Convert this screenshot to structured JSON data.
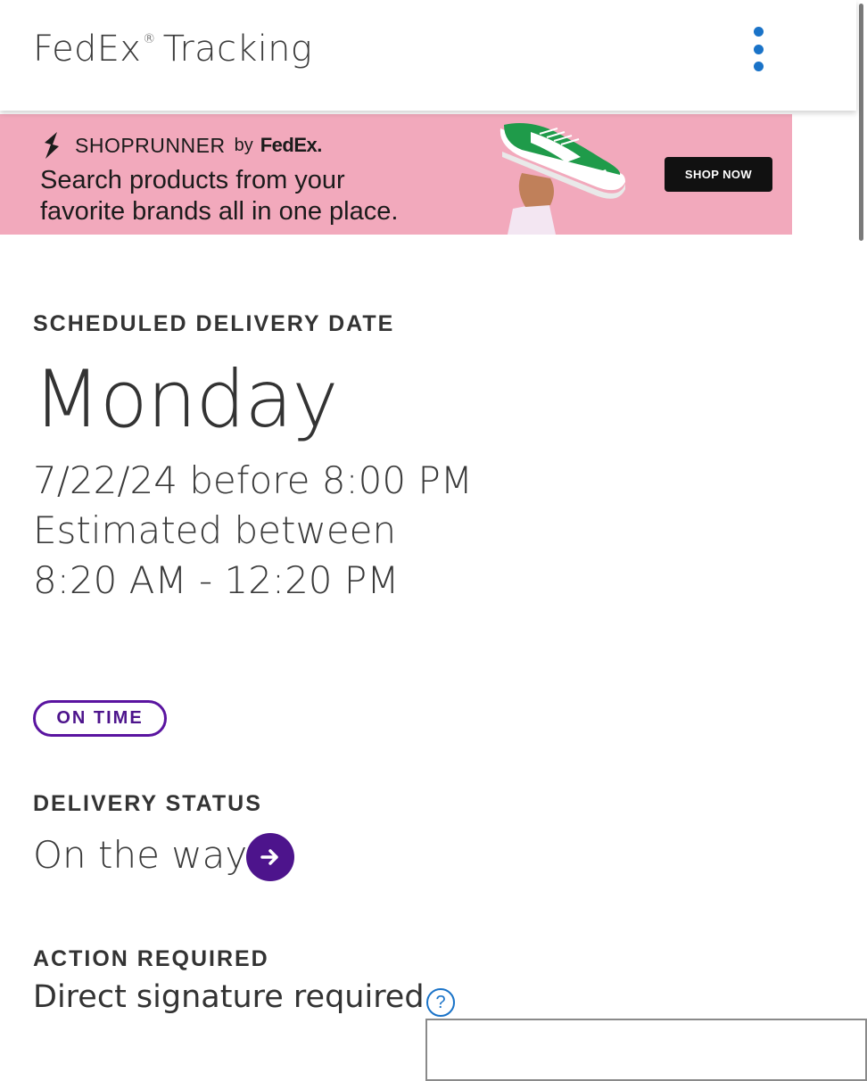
{
  "appbar": {
    "title": "FedEx",
    "reg_mark": "®",
    "title_suffix": "Tracking",
    "menu_icon": "more-vertical-icon"
  },
  "banner": {
    "brand": "SHOPRUNNER",
    "by": "by",
    "partner": "FedEx.",
    "line1": "Search products from your",
    "line2": "favorite brands all in one place.",
    "cta": "SHOP NOW",
    "background_color": "#f2a9bc"
  },
  "schedule": {
    "label": "SCHEDULED DELIVERY DATE",
    "day": "Monday",
    "date_line": "7/22/24 before 8:00 PM",
    "estimate_line": "Estimated between",
    "window_line": "8:20 AM - 12:20 PM"
  },
  "badge": {
    "text": "ON TIME",
    "color": "#4d148c"
  },
  "delivery_status": {
    "label": "DELIVERY STATUS",
    "value": "On the way",
    "icon": "arrow-right-circle-icon"
  },
  "action": {
    "label": "ACTION REQUIRED",
    "value": "Direct signature required",
    "help_glyph": "?",
    "help_icon": "help-circle-icon"
  },
  "colors": {
    "accent_purple": "#4d148c",
    "link_blue": "#1a73c8",
    "text": "#333333"
  }
}
